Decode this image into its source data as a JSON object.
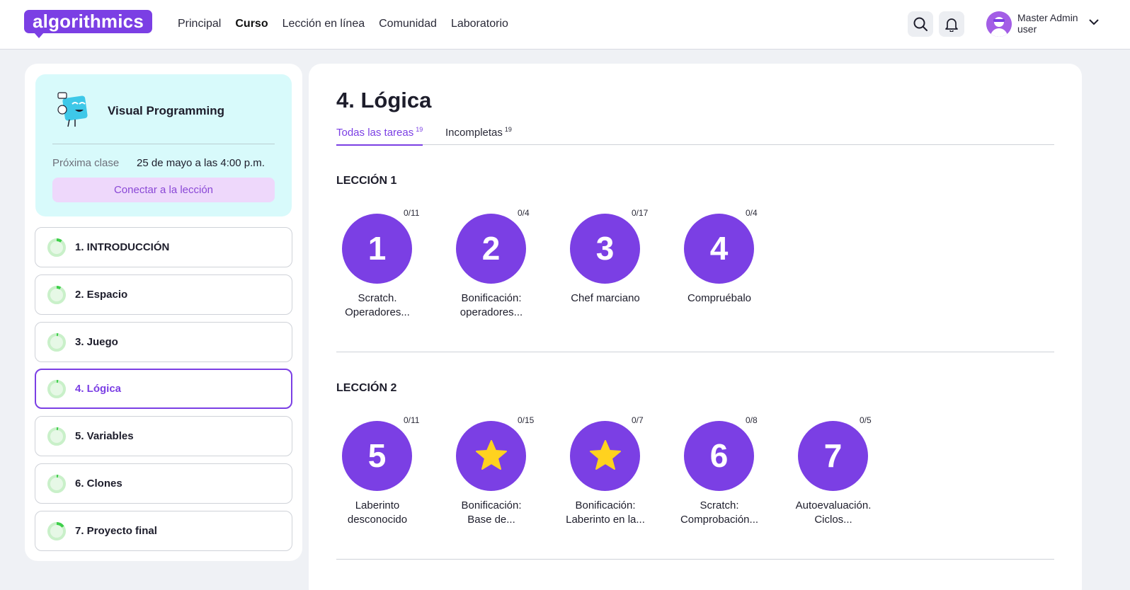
{
  "header": {
    "logo": "algorithmics",
    "nav": [
      "Principal",
      "Curso",
      "Lección en línea",
      "Comunidad",
      "Laboratorio"
    ],
    "active_nav": "Curso",
    "user": {
      "name": "Master Admin",
      "role": "user"
    }
  },
  "course": {
    "title": "Visual Programming",
    "next_label": "Próxima clase",
    "next_value": "25 de mayo a las 4:00 p.m.",
    "connect_label": "Conectar a la lección"
  },
  "modules": [
    {
      "label": "1. INTRODUCCIÓN",
      "progress": 0.1
    },
    {
      "label": "2. Espacio",
      "progress": 0.08
    },
    {
      "label": "3. Juego",
      "progress": 0.03
    },
    {
      "label": "4. Lógica",
      "progress": 0.03,
      "active": true
    },
    {
      "label": "5. Variables",
      "progress": 0.03
    },
    {
      "label": "6. Clones",
      "progress": 0.03
    },
    {
      "label": "7. Proyecto final",
      "progress": 0.15
    }
  ],
  "main": {
    "title": "4. Lógica",
    "tabs": [
      {
        "label": "Todas las tareas",
        "count": "19"
      },
      {
        "label": "Incompletas",
        "count": "19"
      }
    ],
    "lessons": [
      {
        "title": "LECCIÓN 1",
        "tasks": [
          {
            "badge": "1",
            "score": "0/11",
            "name1": "Scratch.",
            "name2": "Operadores..."
          },
          {
            "badge": "2",
            "score": "0/4",
            "name1": "Bonificación:",
            "name2": "operadores..."
          },
          {
            "badge": "3",
            "score": "0/17",
            "name1": "Chef marciano",
            "name2": ""
          },
          {
            "badge": "4",
            "score": "0/4",
            "name1": "Compruébalo",
            "name2": ""
          }
        ]
      },
      {
        "title": "LECCIÓN 2",
        "tasks": [
          {
            "badge": "5",
            "score": "0/11",
            "name1": "Laberinto",
            "name2": "desconocido"
          },
          {
            "badge": "star-icon",
            "score": "0/15",
            "name1": "Bonificación:",
            "name2": "Base de..."
          },
          {
            "badge": "star-icon",
            "score": "0/7",
            "name1": "Bonificación:",
            "name2": "Laberinto en la..."
          },
          {
            "badge": "6",
            "score": "0/8",
            "name1": "Scratch:",
            "name2": "Comprobación..."
          },
          {
            "badge": "7",
            "score": "0/5",
            "name1": "Autoevaluación.",
            "name2": "Ciclos..."
          }
        ]
      }
    ]
  },
  "colors": {
    "accent": "#7b3fe4",
    "star": "#ffd21f",
    "card": "#d8fafb",
    "progress": "#3ecf4a"
  }
}
